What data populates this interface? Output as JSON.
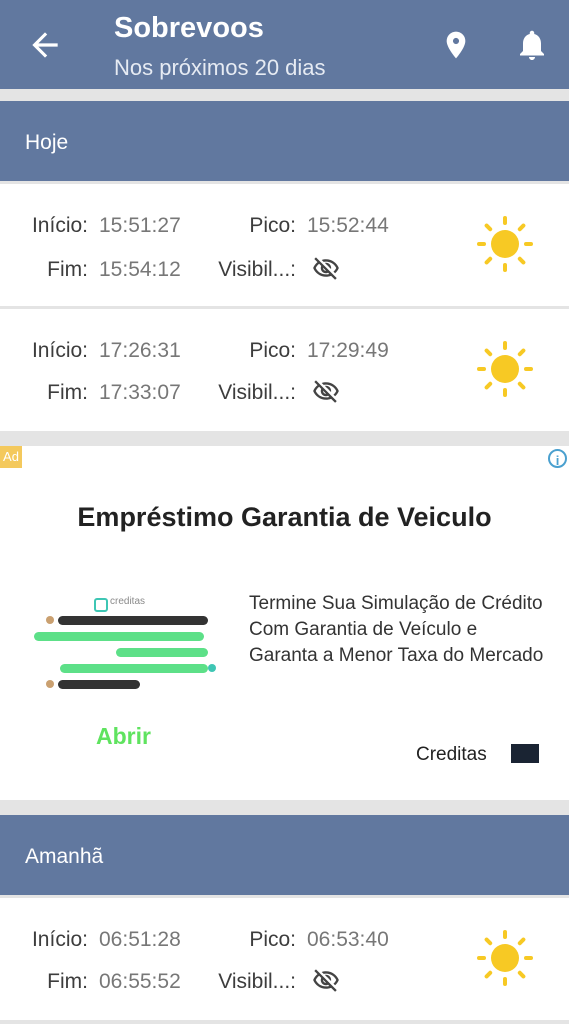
{
  "appbar": {
    "title": "Sobrevoos",
    "subtitle": "Nos próximos 20 dias",
    "back_icon": "arrow-left-icon",
    "location_icon": "map-pin-icon",
    "notification_icon": "bell-icon"
  },
  "labels": {
    "start": "Início:",
    "peak": "Pico:",
    "end": "Fim:",
    "visibility": "Visibil...:"
  },
  "sections": [
    {
      "title": "Hoje",
      "passes": [
        {
          "start": "15:51:27",
          "peak": "15:52:44",
          "end": "15:54:12",
          "visibility_icon": "eye-off-icon",
          "weather_icon": "sun-icon"
        },
        {
          "start": "17:26:31",
          "peak": "17:29:49",
          "end": "17:33:07",
          "visibility_icon": "eye-off-icon",
          "weather_icon": "sun-icon"
        }
      ]
    },
    {
      "title": "Amanhã",
      "passes": [
        {
          "start": "06:51:28",
          "peak": "06:53:40",
          "end": "06:55:52",
          "visibility_icon": "eye-off-icon",
          "weather_icon": "sun-icon"
        }
      ]
    }
  ],
  "ad": {
    "badge": "Ad",
    "info": "i",
    "title": "Empréstimo Garantia de Veiculo",
    "body": "Termine Sua Simulação de Crédito Com Garantia de Veículo e Garanta a Menor Taxa do Mercado",
    "cta": "Abrir",
    "advertiser": "Creditas",
    "image_brand": "creditas"
  },
  "colors": {
    "appbar": "#61789f",
    "sun": "#f7c924",
    "ad_cta": "#5fe35f"
  }
}
